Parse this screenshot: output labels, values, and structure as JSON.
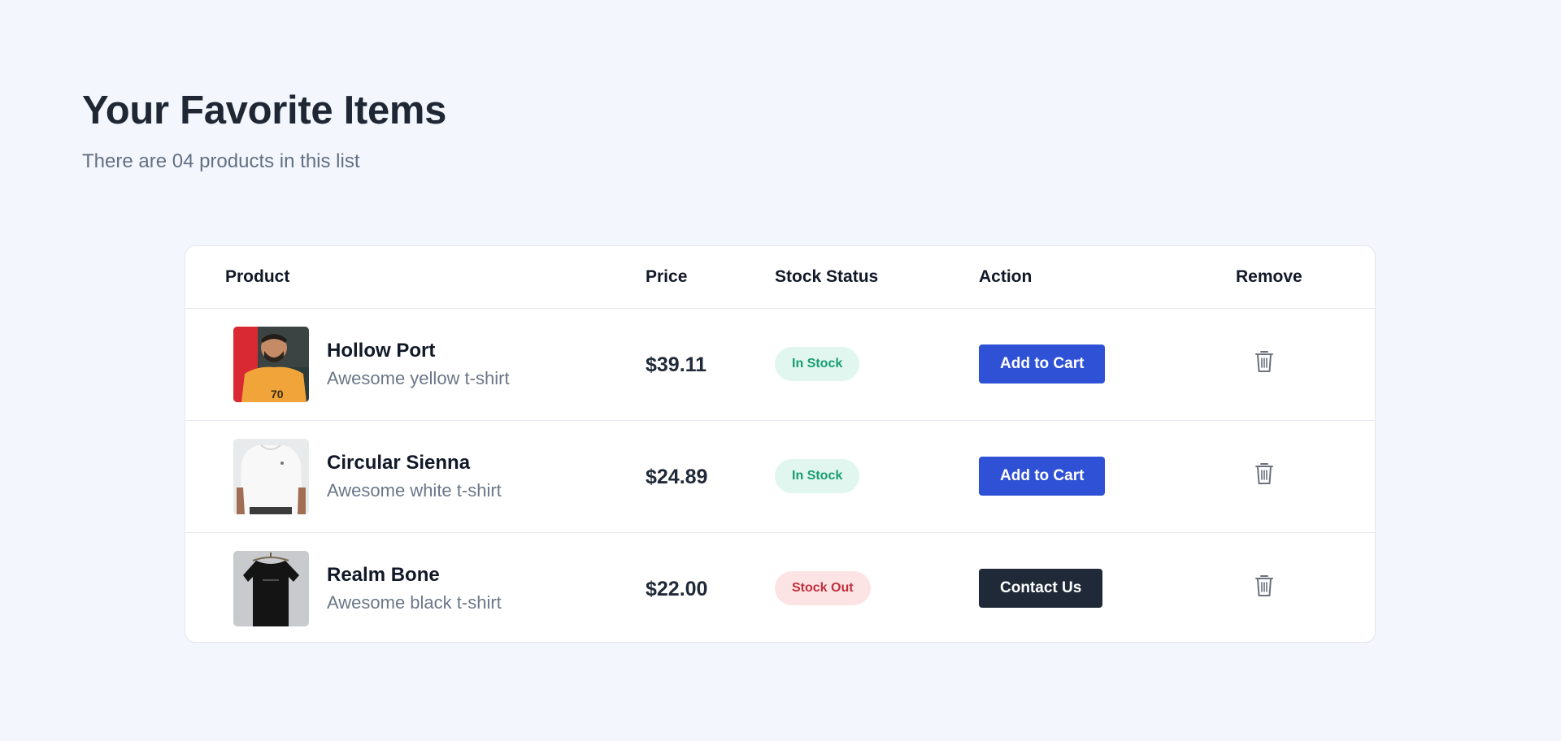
{
  "header": {
    "title": "Your Favorite Items",
    "subtitle": "There are 04 products in this list"
  },
  "table": {
    "columns": {
      "product": "Product",
      "price": "Price",
      "stock": "Stock Status",
      "action": "Action",
      "remove": "Remove"
    },
    "rows": [
      {
        "name": "Hollow Port",
        "description": "Awesome yellow t-shirt",
        "price": "$39.11",
        "stock": "In Stock",
        "action": "Add to Cart",
        "thumb_icon": "yellow-tshirt-photo"
      },
      {
        "name": "Circular Sienna",
        "description": "Awesome white t-shirt",
        "price": "$24.89",
        "stock": "In Stock",
        "action": "Add to Cart",
        "thumb_icon": "white-tshirt-photo"
      },
      {
        "name": "Realm Bone",
        "description": "Awesome black t-shirt",
        "price": "$22.00",
        "stock": "Stock Out",
        "action": "Contact Us",
        "thumb_icon": "black-tshirt-photo"
      }
    ]
  },
  "colors": {
    "page_background": "#f3f6fd",
    "primary_button": "#2f51d6",
    "dark_button": "#1f2937",
    "in_stock_text": "#1a9d72",
    "in_stock_bg": "#e0f6ef",
    "stock_out_text": "#c0303c",
    "stock_out_bg": "#fde4e4"
  },
  "icons": {
    "remove": "trash-icon"
  }
}
